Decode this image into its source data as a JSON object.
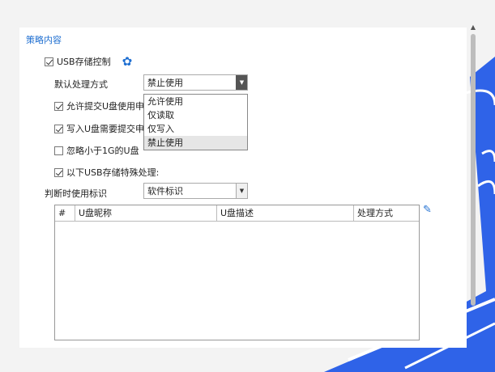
{
  "section": {
    "title": "策略内容"
  },
  "usb_control": {
    "label": "USB存储控制",
    "checked": true
  },
  "default_handling": {
    "label": "默认处理方式",
    "value": "禁止使用"
  },
  "dropdown": {
    "options": [
      "允许使用",
      "仅读取",
      "仅写入",
      "禁止使用"
    ],
    "selected": "禁止使用"
  },
  "options": [
    {
      "label": "允许提交U盘使用申",
      "checked": true
    },
    {
      "label": "写入U盘需要提交申",
      "checked": true
    },
    {
      "label": "忽略小于1G的U盘",
      "checked": false
    },
    {
      "label": "以下USB存储特殊处理:",
      "checked": true
    }
  ],
  "identify": {
    "label": "判断时使用标识",
    "value": "软件标识"
  },
  "table": {
    "columns": [
      "#",
      "U盘昵称",
      "U盘描述",
      "处理方式"
    ],
    "rows": []
  },
  "icons": {
    "settings": "gear-icon",
    "edit": "pencil-icon"
  },
  "colors": {
    "accent": "#1f6fd1",
    "deco": "#2f63e8"
  }
}
